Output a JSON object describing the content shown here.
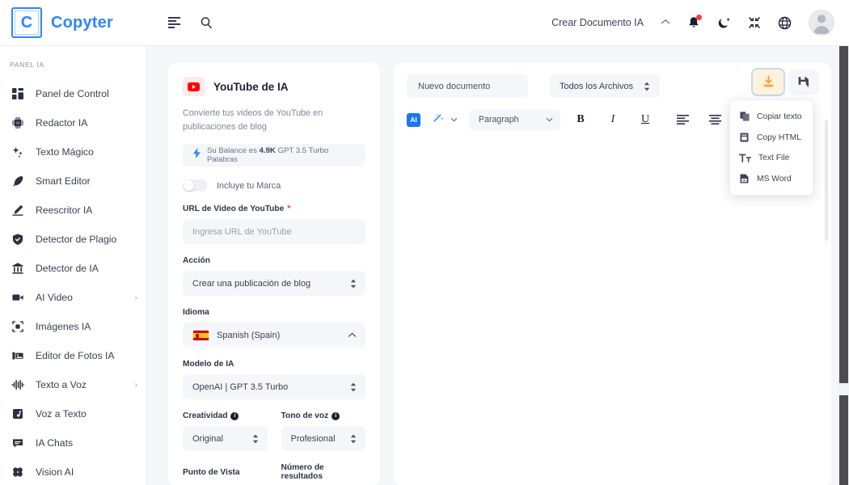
{
  "header": {
    "logo_letter": "C",
    "brand": "Copyter",
    "icons": [
      {
        "name": "menu-icon"
      },
      {
        "name": "search-icon"
      }
    ],
    "create_doc_label": "Crear Documento IA",
    "right_icons": [
      {
        "name": "notifications-bell-icon"
      },
      {
        "name": "dark-mode-moon-icon"
      },
      {
        "name": "fullscreen-compress-icon"
      },
      {
        "name": "language-globe-icon"
      },
      {
        "name": "user-avatar"
      }
    ]
  },
  "sidebar": {
    "section_title": "PANEL IA",
    "items": [
      {
        "label": "Panel de Control",
        "icon": "dashboard-icon",
        "arrow": false
      },
      {
        "label": "Redactor IA",
        "icon": "chip-icon",
        "arrow": false
      },
      {
        "label": "Texto Mágico",
        "icon": "sparkles-icon",
        "arrow": false
      },
      {
        "label": "Smart Editor",
        "icon": "pen-icon",
        "arrow": false
      },
      {
        "label": "Reescritor IA",
        "icon": "pencil-icon",
        "arrow": false
      },
      {
        "label": "Detector de Plagio",
        "icon": "shield-icon",
        "arrow": false
      },
      {
        "label": "Detector de IA",
        "icon": "bank-icon",
        "arrow": false
      },
      {
        "label": "AI Video",
        "icon": "video-camera-icon",
        "arrow": true
      },
      {
        "label": "Imágenes IA",
        "icon": "image-frame-icon",
        "arrow": false
      },
      {
        "label": "Editor de Fotos IA",
        "icon": "photo-editor-icon",
        "arrow": false
      },
      {
        "label": "Texto a Voz",
        "icon": "waveform-icon",
        "arrow": true
      },
      {
        "label": "Voz a Texto",
        "icon": "audio-file-icon",
        "arrow": false
      },
      {
        "label": "IA Chats",
        "icon": "chat-icon",
        "arrow": false
      },
      {
        "label": "Vision AI",
        "icon": "brain-icon",
        "arrow": false
      }
    ]
  },
  "form_card": {
    "icon": "youtube-icon",
    "title": "YouTube de IA",
    "description": "Convierte tus videos de YouTube en publicaciones de blog",
    "balance_icon": "lightning-bolt-icon",
    "balance_prefix": "Su Balance es ",
    "balance_amount": "4.9K",
    "balance_suffix": " GPT 3.5 Turbo Palabras",
    "brand_toggle_label": "Incluye tu Marca",
    "brand_toggle_on": false,
    "fields": {
      "url_label": "URL de Video de YouTube",
      "url_required": "*",
      "url_placeholder": "Ingresa URL de YouTube",
      "url_value": "",
      "accion_label": "Acción",
      "accion_value": "Crear una publicación de blog",
      "idioma_label": "Idioma",
      "idioma_value": "Spanish (Spain)",
      "modelo_label": "Modelo de IA",
      "modelo_value": "OpenAI | GPT 3.5 Turbo",
      "creatividad_label": "Creatividad",
      "creatividad_value": "Original",
      "tono_label": "Tono de voz",
      "tono_value": "Profesional",
      "punto_vista_label": "Punto de Vista",
      "numero_resultados_label": "Número de resultados"
    }
  },
  "editor": {
    "doc_name_value": "Nuevo documento",
    "files_filter_value": "Todos los Archivos",
    "toolbar": {
      "ai_badge": "AI",
      "magic_wand_icon": "magic-wand-icon",
      "paragraph_value": "Paragraph",
      "bold": "B",
      "italic": "I",
      "underline": "U",
      "align_left_icon": "align-left-icon",
      "align_center_icon": "align-center-icon",
      "align_right_icon": "align-right-icon",
      "more_icon": "more-options-icon"
    },
    "export": {
      "download_button_icon": "download-icon",
      "save_button_icon": "save-document-icon",
      "menu_items": [
        {
          "label": "Copiar texto",
          "icon": "copy-icon"
        },
        {
          "label": "Copy HTML",
          "icon": "html-file-icon"
        },
        {
          "label": "Text File",
          "icon": "text-format-icon"
        },
        {
          "label": "MS Word",
          "icon": "word-file-icon"
        }
      ]
    }
  },
  "colors": {
    "brand_blue": "#2f86f6",
    "accent_blue": "#1877f2",
    "youtube_red": "#ff0000",
    "highlight_red": "#ff0000",
    "download_active_bg": "#fdf3dd",
    "page_bg": "#f4f6fa"
  }
}
